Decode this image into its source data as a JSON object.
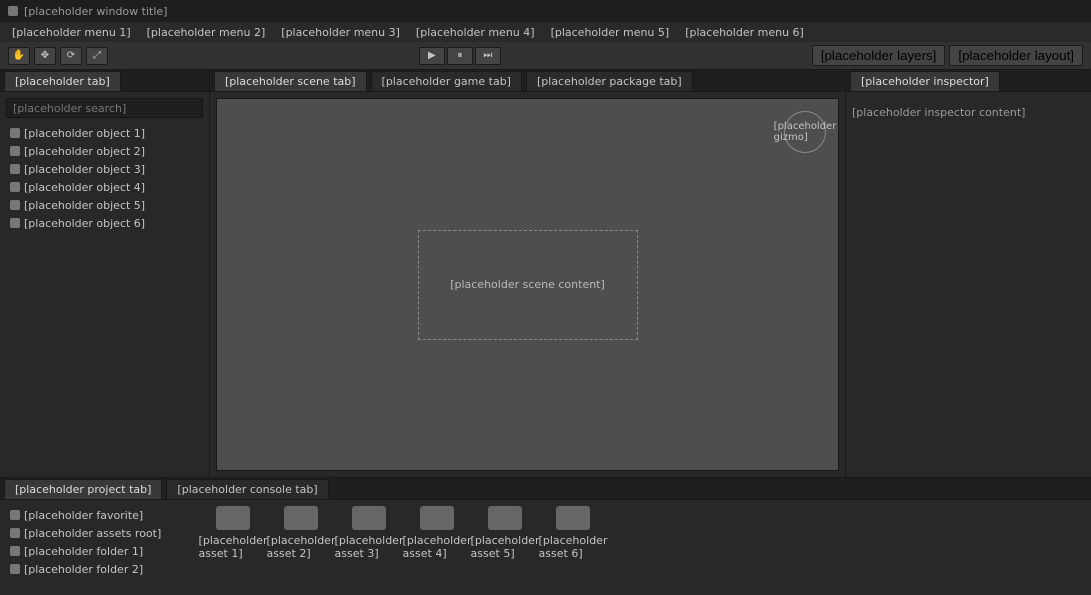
{
  "window": {
    "title": "[placeholder window title]"
  },
  "menubar": {
    "items": [
      "[placeholder menu 1]",
      "[placeholder menu 2]",
      "[placeholder menu 3]",
      "[placeholder menu 4]",
      "[placeholder menu 5]",
      "[placeholder menu 6]"
    ]
  },
  "toolbar": {
    "left_icons": [
      "hand-icon",
      "move-icon",
      "rotate-icon",
      "scale-icon"
    ],
    "play_icons": [
      "play-icon",
      "pause-icon",
      "step-icon"
    ],
    "right_labels": [
      "[placeholder layers]",
      "[placeholder layout]"
    ]
  },
  "hierarchy": {
    "tab_label": "[placeholder tab]",
    "search_placeholder": "[placeholder search]",
    "items": [
      "[placeholder object 1]",
      "[placeholder object 2]",
      "[placeholder object 3]",
      "[placeholder object 4]",
      "[placeholder object 5]",
      "[placeholder object 6]"
    ]
  },
  "scene": {
    "tabs": [
      "[placeholder scene tab]",
      "[placeholder game tab]",
      "[placeholder package tab]"
    ],
    "placeholder_note": "[placeholder scene content]",
    "gizmo_label": "[placeholder gizmo]"
  },
  "inspector": {
    "tab_label": "[placeholder inspector]",
    "empty_text": "[placeholder inspector content]"
  },
  "project": {
    "tabs": [
      "[placeholder project tab]",
      "[placeholder console tab]"
    ],
    "tree_items": [
      "[placeholder favorite]",
      "[placeholder assets root]",
      "[placeholder folder 1]",
      "[placeholder folder 2]"
    ],
    "assets": [
      "[placeholder asset 1]",
      "[placeholder asset 2]",
      "[placeholder asset 3]",
      "[placeholder asset 4]",
      "[placeholder asset 5]",
      "[placeholder asset 6]"
    ]
  }
}
